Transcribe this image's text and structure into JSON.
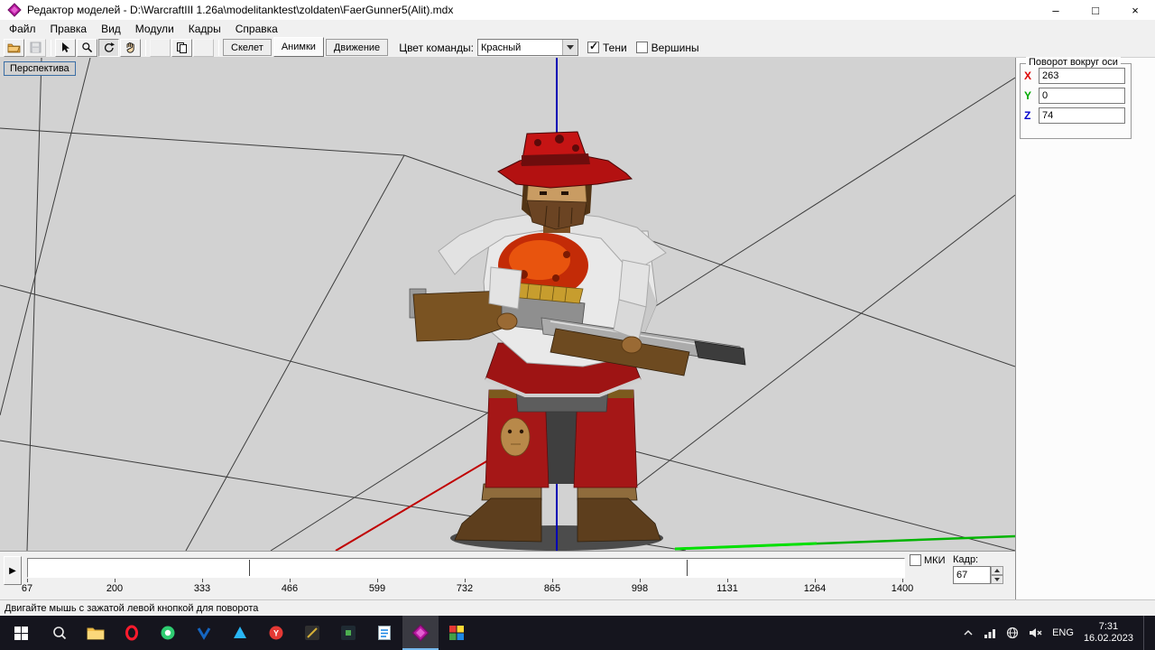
{
  "window": {
    "title": "Редактор моделей - D:\\WarcraftIII 1.26a\\modelitanktest\\zoldaten\\FaerGunner5(Alit).mdx",
    "controls": {
      "minimize": "–",
      "maximize": "□",
      "close": "×"
    }
  },
  "menu": {
    "items": [
      "Файл",
      "Правка",
      "Вид",
      "Модули",
      "Кадры",
      "Справка"
    ]
  },
  "toolbar": {
    "icons": [
      "open-folder-icon",
      "save-icon",
      "select-arrow-icon",
      "zoom-icon",
      "rotate-icon",
      "pan-hand-icon",
      "copy-icon"
    ],
    "mode_tabs": [
      {
        "label": "Скелет",
        "active": false
      },
      {
        "label": "Анимки",
        "active": true
      },
      {
        "label": "Движение",
        "active": false
      }
    ],
    "team_color": {
      "label": "Цвет команды:",
      "value": "Красный"
    },
    "shadows": {
      "label": "Тени",
      "checked": true
    },
    "vertices": {
      "label": "Вершины",
      "checked": false
    }
  },
  "viewport": {
    "label": "Перспектива",
    "background": "#d2d2d2",
    "axis_colors": {
      "x": "#c00000",
      "y": "#00b400",
      "z": "#0000b4"
    }
  },
  "rotation_panel": {
    "title": "Поворот вокруг оси",
    "x": {
      "label": "X",
      "value": "263",
      "color": "#dd0000"
    },
    "y": {
      "label": "Y",
      "value": "0",
      "color": "#00aa00"
    },
    "z": {
      "label": "Z",
      "value": "74",
      "color": "#0000cc"
    }
  },
  "timeline": {
    "play_icon": "▶",
    "ticks": [
      "67",
      "200",
      "333",
      "466",
      "599",
      "732",
      "865",
      "998",
      "1131",
      "1264",
      "1400"
    ],
    "mki": {
      "label": "МКИ",
      "checked": false
    },
    "frame": {
      "label": "Кадр:",
      "value": "67"
    }
  },
  "status_bar": {
    "text": "Двигайте мышь с зажатой левой кнопкой для поворота"
  },
  "taskbar": {
    "apps": [
      "windows-start",
      "search",
      "file-explorer",
      "opera",
      "green-browser",
      "blue-v-app",
      "blue-triangle-app",
      "red-y-app",
      "dark-app-1",
      "dark-app-2",
      "blue-doc-app",
      "model-editor",
      "image-tool-app"
    ],
    "active_app": "model-editor",
    "tray": {
      "icons": [
        "hidden-icons-chevron",
        "network-icon",
        "globe-icon",
        "volume-muted-icon"
      ],
      "language": "ENG",
      "time": "7:31",
      "date": "16.02.2023"
    }
  }
}
